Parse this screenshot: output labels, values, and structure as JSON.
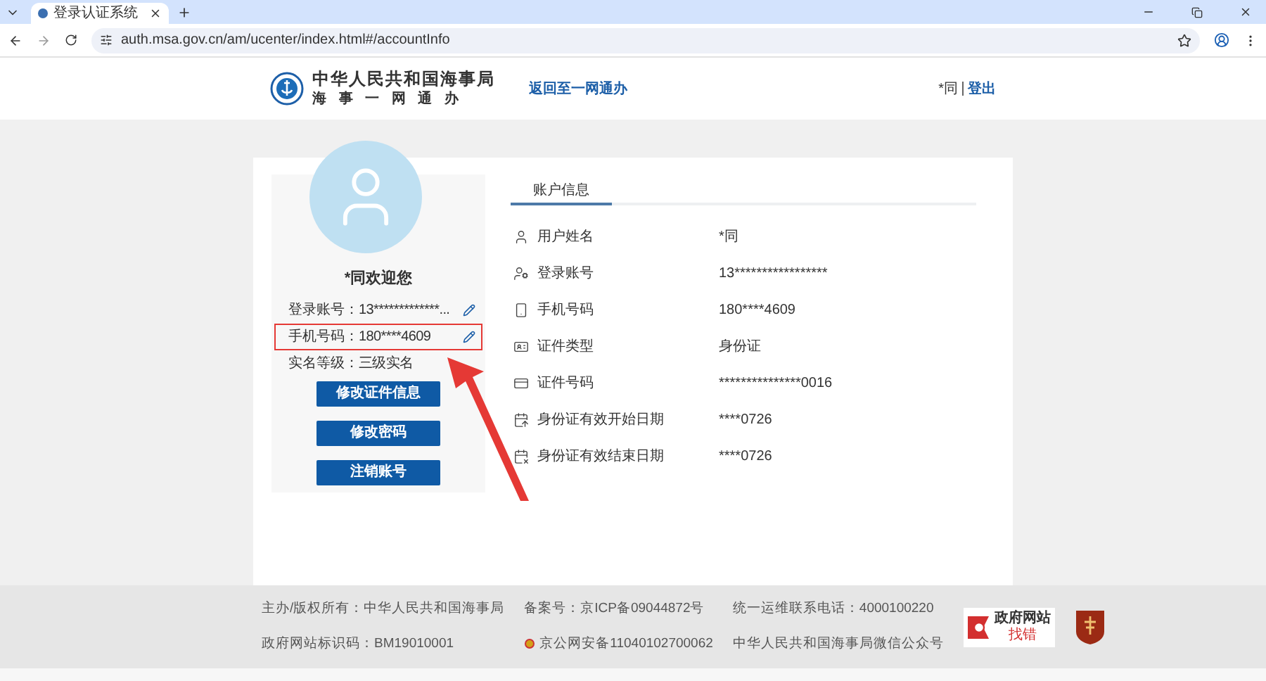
{
  "browser": {
    "tabs": [
      {
        "title": "登录认证系统",
        "selected": true
      }
    ],
    "url": "auth.msa.gov.cn/am/ucenter/index.html#/accountInfo"
  },
  "header": {
    "org_name": "中华人民共和国海事局",
    "org_sub": "海 事 一 网 通 办",
    "back_link": "返回至一网通办",
    "user": "*同",
    "logout": "登出"
  },
  "profile": {
    "welcome": "*同欢迎您",
    "fields": [
      {
        "label": "登录账号：",
        "value": "13*************...",
        "editable": true,
        "highlighted": false
      },
      {
        "label": "手机号码：",
        "value": "180****4609",
        "editable": true,
        "highlighted": true
      },
      {
        "label": "实名等级：",
        "value": "三级实名",
        "editable": false,
        "highlighted": false
      }
    ],
    "buttons": [
      "修改证件信息",
      "修改密码",
      "注销账号"
    ]
  },
  "account_tabs": [
    {
      "label": "账户信息",
      "selected": true
    }
  ],
  "account_info": [
    {
      "kind": "user",
      "label": "用户姓名",
      "value": "*同"
    },
    {
      "kind": "account",
      "label": "登录账号",
      "value": "13*****************"
    },
    {
      "kind": "phone",
      "label": "手机号码",
      "value": "180****4609"
    },
    {
      "kind": "card",
      "label": "证件类型",
      "value": "身份证"
    },
    {
      "kind": "idnumber",
      "label": "证件号码",
      "value": "***************0016"
    },
    {
      "kind": "date-start",
      "label": "身份证有效开始日期",
      "value": "****0726"
    },
    {
      "kind": "date-end",
      "label": "身份证有效结束日期",
      "value": "****0726"
    }
  ],
  "footer": {
    "columns": [
      [
        "主办/版权所有：中华人民共和国海事局",
        "政府网站标识码：BM19010001"
      ],
      [
        "备案号：京ICP备09044872号",
        "京公网安备11040102700062"
      ],
      [
        "统一运维联系电话：4000100220",
        "中华人民共和国海事局微信公众号"
      ]
    ],
    "badge_title": "政府网站",
    "badge_sub": "找错"
  }
}
